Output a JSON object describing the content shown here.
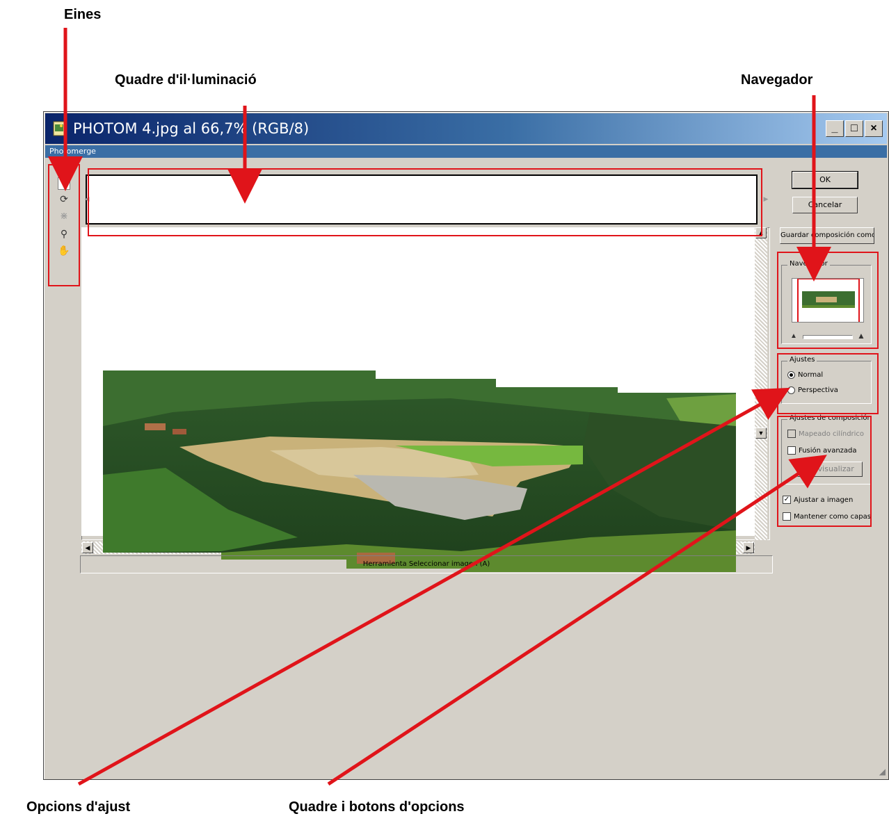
{
  "callouts": {
    "tools": "Eines",
    "lightbox": "Quadre d'il·luminació",
    "navigator": "Navegador",
    "settings_options": "Opcions d'ajust",
    "option_box": "Quadre i botons d'opcions"
  },
  "window": {
    "title": "PHOTOM 4.jpg al 66,7% (RGB/8)",
    "menu": "Photomerge",
    "minimize": "_",
    "maximize": "□",
    "close": "×"
  },
  "toolbox": {
    "tools": [
      "select-image-tool",
      "rotate-image-tool",
      "set-vanishing-point-tool",
      "zoom-tool",
      "hand-tool"
    ]
  },
  "status": "Herramienta Seleccionar imagen (A)",
  "buttons": {
    "ok": "OK",
    "cancel": "Cancelar",
    "save_composition": "Guardar composición como..."
  },
  "navigator": {
    "title": "Navegador"
  },
  "settings": {
    "title": "Ajustes",
    "normal": "Normal",
    "perspective": "Perspectiva",
    "selected": "normal"
  },
  "composition": {
    "title": "Ajustes de composición",
    "cylindrical": "Mapeado cilíndrico",
    "cylindrical_checked": false,
    "advanced_blend": "Fusión avanzada",
    "advanced_blend_checked": false,
    "preview": "Previsualizar",
    "snap": "Ajustar a imagen",
    "snap_checked": true,
    "keep_layers": "Mantener como capas",
    "keep_layers_checked": false
  },
  "colors": {
    "highlight": "#e0141a",
    "title_bar": "#0a246a",
    "dialog": "#d4d0c8"
  }
}
